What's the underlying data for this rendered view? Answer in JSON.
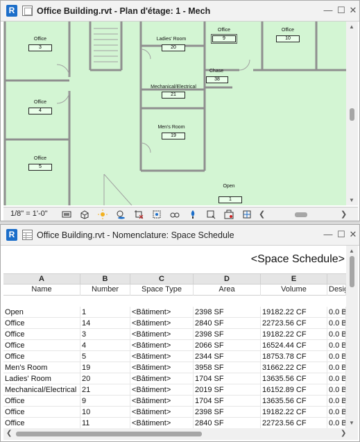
{
  "app_badge": "R",
  "plan_window": {
    "title": "Office Building.rvt - Plan d'étage: 1 - Mech",
    "scale": "1/8\" = 1'-0\"",
    "rooms": [
      {
        "name": "Office",
        "number": "3"
      },
      {
        "name": "Office",
        "number": "4"
      },
      {
        "name": "Office",
        "number": "5"
      },
      {
        "name": "Ladies' Room",
        "number": "20"
      },
      {
        "name": "Mechanical/Electrical",
        "number": "21"
      },
      {
        "name": "Men's Room",
        "number": "19"
      },
      {
        "name": "Office",
        "number": "9"
      },
      {
        "name": "Office",
        "number": "10"
      },
      {
        "name": "Chase",
        "number": "38"
      },
      {
        "name": "Open",
        "number": "1"
      }
    ]
  },
  "schedule_window": {
    "title": "Office Building.rvt - Nomenclature: Space Schedule",
    "schedule_title": "<Space Schedule>",
    "column_letters": [
      "A",
      "B",
      "C",
      "D",
      "E",
      ""
    ],
    "column_headers": [
      "Name",
      "Number",
      "Space Type",
      "Area",
      "Volume",
      "Desig"
    ],
    "rows": [
      [
        "Open",
        "1",
        "<Bâtiment>",
        "2398 SF",
        "19182.22 CF",
        "0.0 B"
      ],
      [
        "Office",
        "14",
        "<Bâtiment>",
        "2840 SF",
        "22723.56 CF",
        "0.0 B"
      ],
      [
        "Office",
        "3",
        "<Bâtiment>",
        "2398 SF",
        "19182.22 CF",
        "0.0 B"
      ],
      [
        "Office",
        "4",
        "<Bâtiment>",
        "2066 SF",
        "16524.44 CF",
        "0.0 B"
      ],
      [
        "Office",
        "5",
        "<Bâtiment>",
        "2344 SF",
        "18753.78 CF",
        "0.0 B"
      ],
      [
        "Men's Room",
        "19",
        "<Bâtiment>",
        "3958 SF",
        "31662.22 CF",
        "0.0 B"
      ],
      [
        "Ladies' Room",
        "20",
        "<Bâtiment>",
        "1704 SF",
        "13635.56 CF",
        "0.0 B"
      ],
      [
        "Mechanical/Electrical",
        "21",
        "<Bâtiment>",
        "2019 SF",
        "16152.89 CF",
        "0.0 B"
      ],
      [
        "Office",
        "9",
        "<Bâtiment>",
        "1704 SF",
        "13635.56 CF",
        "0.0 B"
      ],
      [
        "Office",
        "10",
        "<Bâtiment>",
        "2398 SF",
        "19182.22 CF",
        "0.0 B"
      ],
      [
        "Office",
        "11",
        "<Bâtiment>",
        "2840 SF",
        "22723.56 CF",
        "0.0 B"
      ]
    ]
  },
  "colors": {
    "plan_fill": "#d3f5d3",
    "wall": "#8a8a8a",
    "revit_blue": "#1c6ec9"
  }
}
